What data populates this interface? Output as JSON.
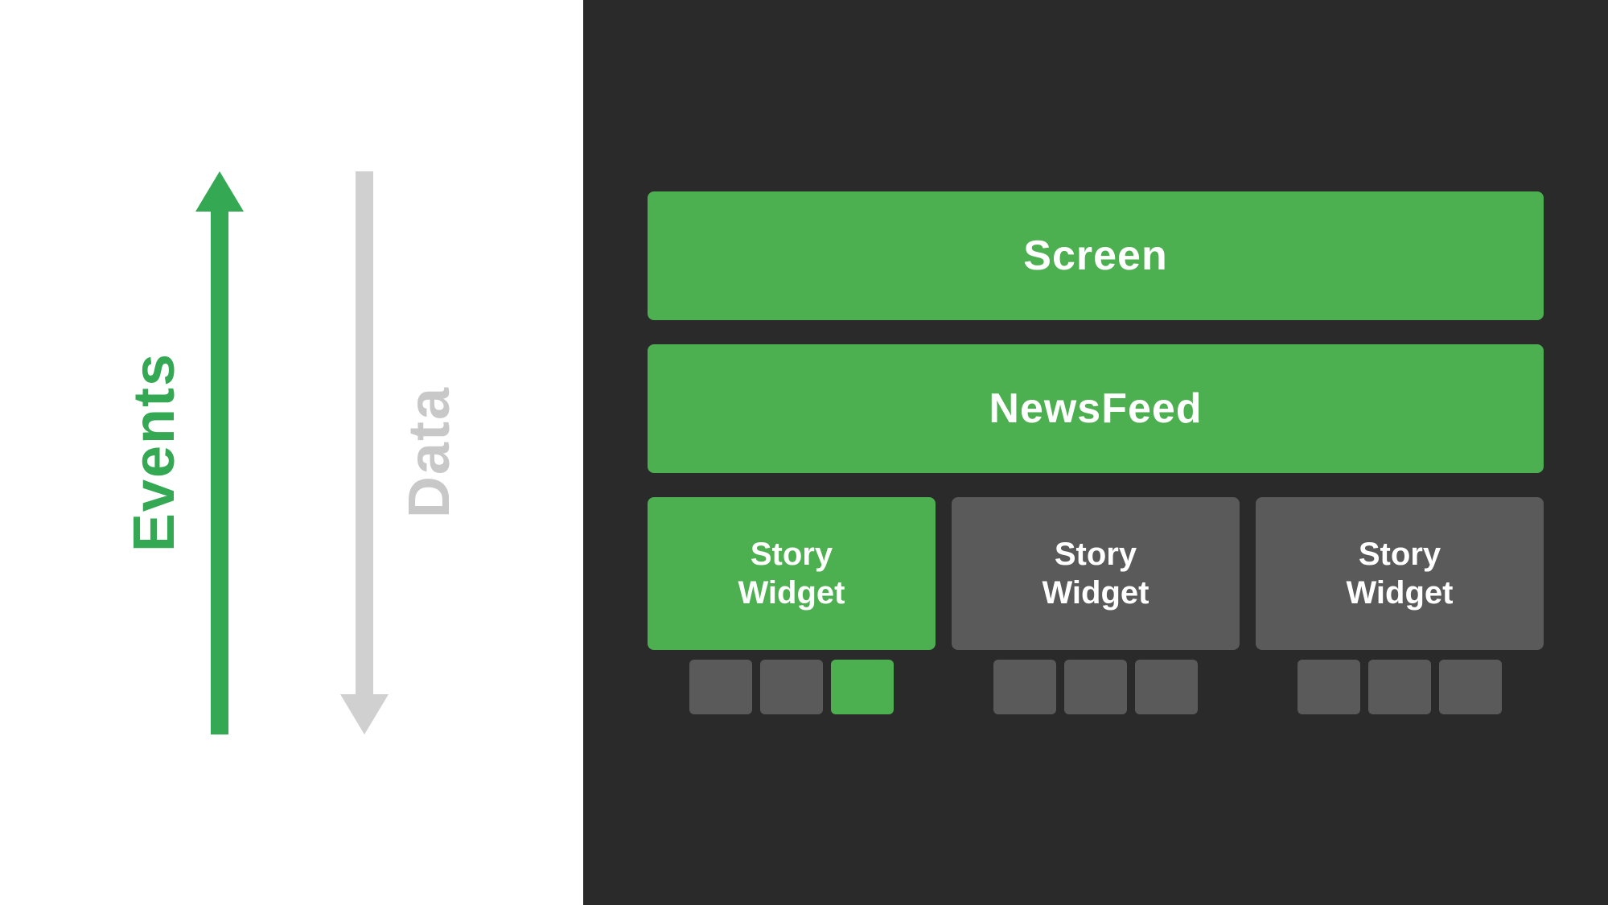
{
  "left_panel": {
    "events_label": "Events",
    "data_label": "Data"
  },
  "right_panel": {
    "screen_label": "Screen",
    "newsfeed_label": "NewsFeed",
    "story_widget_label": "Story\nWidget",
    "colors": {
      "green": "#4caf50",
      "dark_bg": "#2a2a2a",
      "gray_block": "#5a5a5a"
    }
  }
}
